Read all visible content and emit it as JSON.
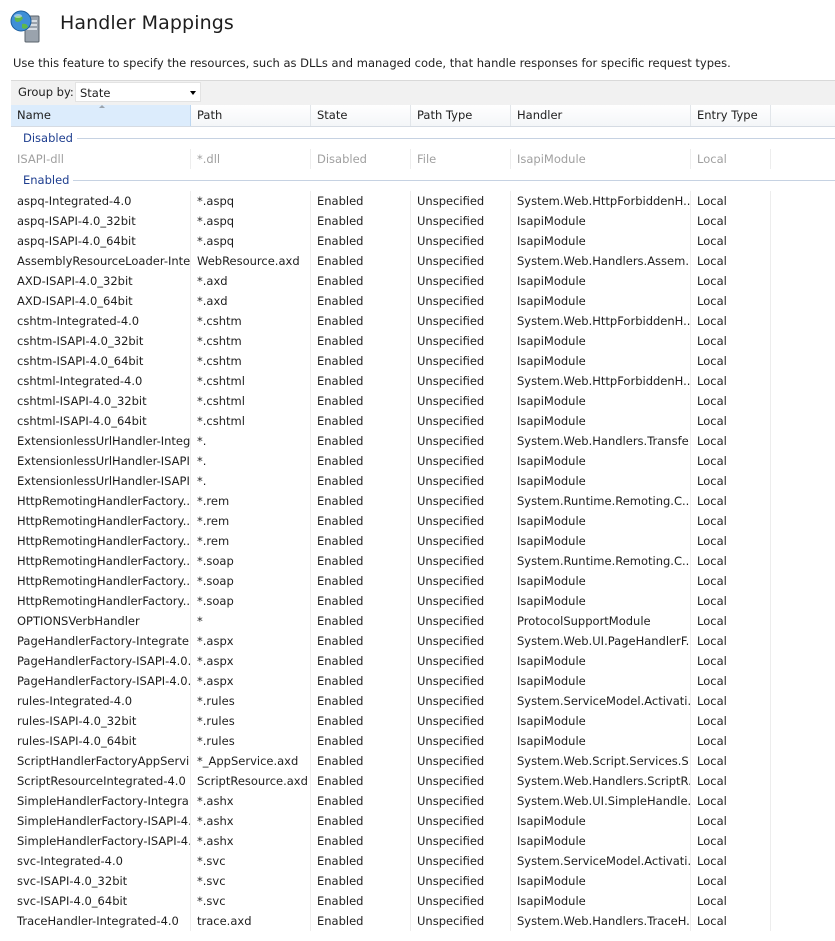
{
  "header": {
    "title": "Handler Mappings",
    "description": "Use this feature to specify the resources, such as DLLs and managed code, that handle responses for specific request types."
  },
  "toolbar": {
    "group_by_label": "Group by:",
    "group_by_value": "State"
  },
  "columns": [
    "Name",
    "Path",
    "State",
    "Path Type",
    "Handler",
    "Entry Type"
  ],
  "groups": [
    {
      "label": "Disabled",
      "rows": [
        [
          "ISAPI-dll",
          "*.dll",
          "Disabled",
          "File",
          "IsapiModule",
          "Local"
        ]
      ]
    },
    {
      "label": "Enabled",
      "rows": [
        [
          "aspq-Integrated-4.0",
          "*.aspq",
          "Enabled",
          "Unspecified",
          "System.Web.HttpForbiddenH...",
          "Local"
        ],
        [
          "aspq-ISAPI-4.0_32bit",
          "*.aspq",
          "Enabled",
          "Unspecified",
          "IsapiModule",
          "Local"
        ],
        [
          "aspq-ISAPI-4.0_64bit",
          "*.aspq",
          "Enabled",
          "Unspecified",
          "IsapiModule",
          "Local"
        ],
        [
          "AssemblyResourceLoader-Inte...",
          "WebResource.axd",
          "Enabled",
          "Unspecified",
          "System.Web.Handlers.Assem...",
          "Local"
        ],
        [
          "AXD-ISAPI-4.0_32bit",
          "*.axd",
          "Enabled",
          "Unspecified",
          "IsapiModule",
          "Local"
        ],
        [
          "AXD-ISAPI-4.0_64bit",
          "*.axd",
          "Enabled",
          "Unspecified",
          "IsapiModule",
          "Local"
        ],
        [
          "cshtm-Integrated-4.0",
          "*.cshtm",
          "Enabled",
          "Unspecified",
          "System.Web.HttpForbiddenH...",
          "Local"
        ],
        [
          "cshtm-ISAPI-4.0_32bit",
          "*.cshtm",
          "Enabled",
          "Unspecified",
          "IsapiModule",
          "Local"
        ],
        [
          "cshtm-ISAPI-4.0_64bit",
          "*.cshtm",
          "Enabled",
          "Unspecified",
          "IsapiModule",
          "Local"
        ],
        [
          "cshtml-Integrated-4.0",
          "*.cshtml",
          "Enabled",
          "Unspecified",
          "System.Web.HttpForbiddenH...",
          "Local"
        ],
        [
          "cshtml-ISAPI-4.0_32bit",
          "*.cshtml",
          "Enabled",
          "Unspecified",
          "IsapiModule",
          "Local"
        ],
        [
          "cshtml-ISAPI-4.0_64bit",
          "*.cshtml",
          "Enabled",
          "Unspecified",
          "IsapiModule",
          "Local"
        ],
        [
          "ExtensionlessUrlHandler-Integ...",
          "*.",
          "Enabled",
          "Unspecified",
          "System.Web.Handlers.Transfe...",
          "Local"
        ],
        [
          "ExtensionlessUrlHandler-ISAPI...",
          "*.",
          "Enabled",
          "Unspecified",
          "IsapiModule",
          "Local"
        ],
        [
          "ExtensionlessUrlHandler-ISAPI...",
          "*.",
          "Enabled",
          "Unspecified",
          "IsapiModule",
          "Local"
        ],
        [
          "HttpRemotingHandlerFactory...",
          "*.rem",
          "Enabled",
          "Unspecified",
          "System.Runtime.Remoting.C...",
          "Local"
        ],
        [
          "HttpRemotingHandlerFactory...",
          "*.rem",
          "Enabled",
          "Unspecified",
          "IsapiModule",
          "Local"
        ],
        [
          "HttpRemotingHandlerFactory...",
          "*.rem",
          "Enabled",
          "Unspecified",
          "IsapiModule",
          "Local"
        ],
        [
          "HttpRemotingHandlerFactory...",
          "*.soap",
          "Enabled",
          "Unspecified",
          "System.Runtime.Remoting.C...",
          "Local"
        ],
        [
          "HttpRemotingHandlerFactory...",
          "*.soap",
          "Enabled",
          "Unspecified",
          "IsapiModule",
          "Local"
        ],
        [
          "HttpRemotingHandlerFactory...",
          "*.soap",
          "Enabled",
          "Unspecified",
          "IsapiModule",
          "Local"
        ],
        [
          "OPTIONSVerbHandler",
          "*",
          "Enabled",
          "Unspecified",
          "ProtocolSupportModule",
          "Local"
        ],
        [
          "PageHandlerFactory-Integrate...",
          "*.aspx",
          "Enabled",
          "Unspecified",
          "System.Web.UI.PageHandlerF...",
          "Local"
        ],
        [
          "PageHandlerFactory-ISAPI-4.0...",
          "*.aspx",
          "Enabled",
          "Unspecified",
          "IsapiModule",
          "Local"
        ],
        [
          "PageHandlerFactory-ISAPI-4.0...",
          "*.aspx",
          "Enabled",
          "Unspecified",
          "IsapiModule",
          "Local"
        ],
        [
          "rules-Integrated-4.0",
          "*.rules",
          "Enabled",
          "Unspecified",
          "System.ServiceModel.Activati...",
          "Local"
        ],
        [
          "rules-ISAPI-4.0_32bit",
          "*.rules",
          "Enabled",
          "Unspecified",
          "IsapiModule",
          "Local"
        ],
        [
          "rules-ISAPI-4.0_64bit",
          "*.rules",
          "Enabled",
          "Unspecified",
          "IsapiModule",
          "Local"
        ],
        [
          "ScriptHandlerFactoryAppServi...",
          "*_AppService.axd",
          "Enabled",
          "Unspecified",
          "System.Web.Script.Services.S...",
          "Local"
        ],
        [
          "ScriptResourceIntegrated-4.0",
          "ScriptResource.axd",
          "Enabled",
          "Unspecified",
          "System.Web.Handlers.ScriptR...",
          "Local"
        ],
        [
          "SimpleHandlerFactory-Integra...",
          "*.ashx",
          "Enabled",
          "Unspecified",
          "System.Web.UI.SimpleHandle...",
          "Local"
        ],
        [
          "SimpleHandlerFactory-ISAPI-4...",
          "*.ashx",
          "Enabled",
          "Unspecified",
          "IsapiModule",
          "Local"
        ],
        [
          "SimpleHandlerFactory-ISAPI-4...",
          "*.ashx",
          "Enabled",
          "Unspecified",
          "IsapiModule",
          "Local"
        ],
        [
          "svc-Integrated-4.0",
          "*.svc",
          "Enabled",
          "Unspecified",
          "System.ServiceModel.Activati...",
          "Local"
        ],
        [
          "svc-ISAPI-4.0_32bit",
          "*.svc",
          "Enabled",
          "Unspecified",
          "IsapiModule",
          "Local"
        ],
        [
          "svc-ISAPI-4.0_64bit",
          "*.svc",
          "Enabled",
          "Unspecified",
          "IsapiModule",
          "Local"
        ],
        [
          "TraceHandler-Integrated-4.0",
          "trace.axd",
          "Enabled",
          "Unspecified",
          "System.Web.Handlers.TraceH...",
          "Local"
        ]
      ]
    }
  ]
}
